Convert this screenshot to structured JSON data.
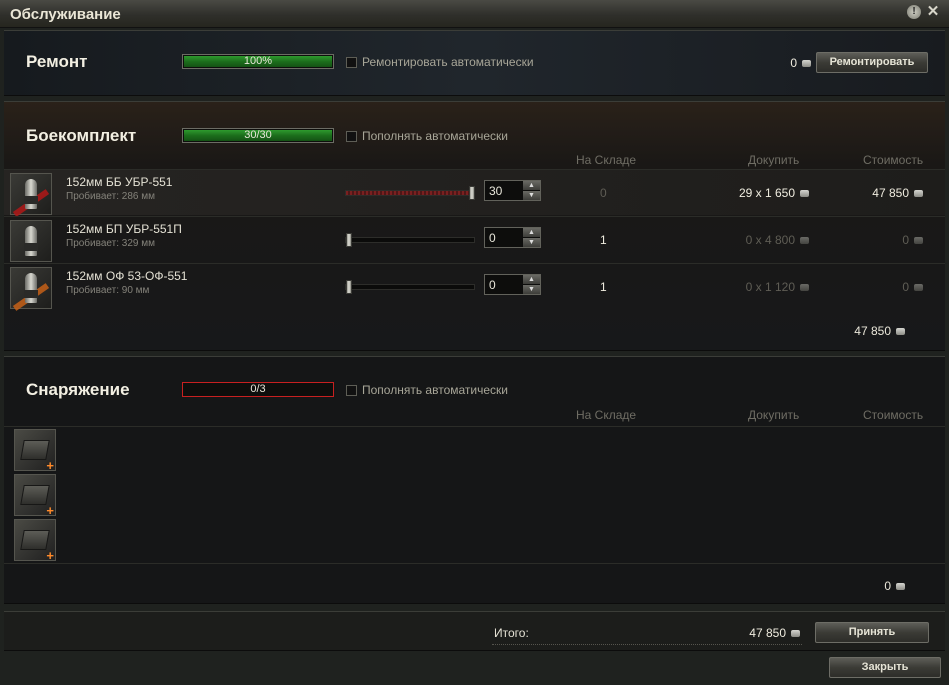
{
  "window": {
    "title": "Обслуживание",
    "help_glyph": "!",
    "close_glyph": "✕"
  },
  "repair": {
    "title": "Ремонт",
    "progress_label": "100%",
    "progress_value": 1.0,
    "auto_label": "Ремонтировать автоматически",
    "cost": "0",
    "button_label": "Ремонтировать"
  },
  "ammo": {
    "title": "Боекомплект",
    "progress_label": "30/30",
    "progress_value": 1.0,
    "auto_label": "Пополнять автоматически",
    "headers": {
      "stock": "На Складе",
      "buy": "Докупить",
      "cost": "Стоимость"
    },
    "items": [
      {
        "name": "152мм ББ УБР-551",
        "sub": "Пробивает: 286 мм",
        "count": "30",
        "slider": 1.0,
        "stock": "0",
        "buy": "29 x 1 650",
        "cost": "47 850",
        "type": "ap"
      },
      {
        "name": "152мм БП УБР-551П",
        "sub": "Пробивает: 329 мм",
        "count": "0",
        "slider": 0.0,
        "stock": "1",
        "buy": "0 x 4 800",
        "cost": "0",
        "type": "apcr"
      },
      {
        "name": "152мм ОФ 53-ОФ-551",
        "sub": "Пробивает: 90 мм",
        "count": "0",
        "slider": 0.0,
        "stock": "1",
        "buy": "0 x 1 120",
        "cost": "0",
        "type": "he"
      }
    ],
    "sum": "47 850"
  },
  "equipment": {
    "title": "Снаряжение",
    "progress_label": "0/3",
    "progress_value": 0.0,
    "auto_label": "Пополнять автоматически",
    "headers": {
      "stock": "На Складе",
      "buy": "Докупить",
      "cost": "Стоимость"
    },
    "slot_plus": "+",
    "sum": "0"
  },
  "footer": {
    "total_label": "Итого:",
    "total_value": "47 850",
    "accept_label": "Принять",
    "close_label": "Закрыть"
  },
  "colors": {
    "accent_green": "#2e9a2e",
    "alert_red": "#c72020",
    "plus_orange": "#ff8a2a"
  }
}
